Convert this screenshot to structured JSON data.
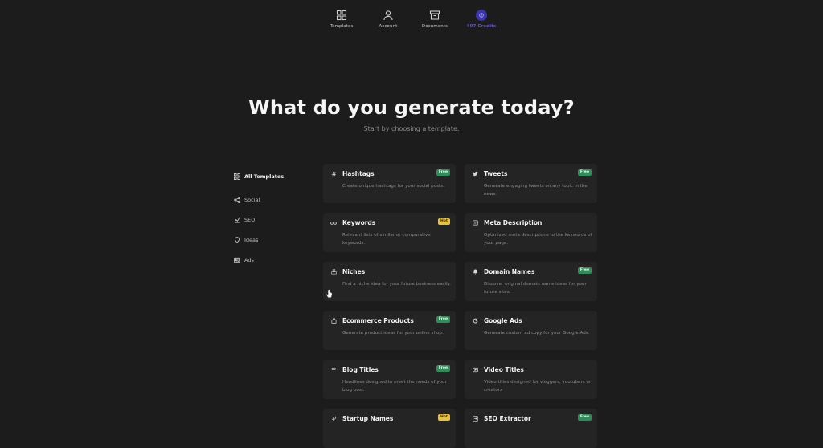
{
  "nav": {
    "items": [
      {
        "label": "Templates",
        "icon": "grid-icon"
      },
      {
        "label": "Account",
        "icon": "user-icon"
      },
      {
        "label": "Documents",
        "icon": "archive-icon"
      },
      {
        "label": "497 Credits",
        "icon": "credits-icon"
      }
    ]
  },
  "hero": {
    "title": "What do you generate today?",
    "subtitle": "Start by choosing a template."
  },
  "sidebar": {
    "items": [
      {
        "label": "All Templates",
        "icon": "grid-icon",
        "active": true
      },
      {
        "label": "Social",
        "icon": "share-icon"
      },
      {
        "label": "SEO",
        "icon": "trend-icon"
      },
      {
        "label": "Ideas",
        "icon": "lightbulb-icon"
      },
      {
        "label": "Ads",
        "icon": "ad-icon"
      }
    ]
  },
  "templates": [
    {
      "title": "Hashtags",
      "desc": "Create unique hashtags for your social posts.",
      "badge": "Free",
      "badge_type": "free",
      "icon": "hash-icon"
    },
    {
      "title": "Tweets",
      "desc": "Generate engaging tweets on any topic in the news.",
      "badge": "Free",
      "badge_type": "free",
      "icon": "twitter-icon"
    },
    {
      "title": "Keywords",
      "desc": "Relevant lists of similar or comparative keywords.",
      "badge": "Hot",
      "badge_type": "hot",
      "icon": "infinity-icon"
    },
    {
      "title": "Meta Description",
      "desc": "Optimized meta descriptions to the keywords of your page.",
      "badge": "",
      "badge_type": "",
      "icon": "document-icon"
    },
    {
      "title": "Niches",
      "desc": "Find a niche idea for your future business easily.",
      "badge": "",
      "badge_type": "",
      "icon": "cubes-icon"
    },
    {
      "title": "Domain Names",
      "desc": "Discover original domain name ideas for your future sites.",
      "badge": "Free",
      "badge_type": "free",
      "icon": "bell-icon"
    },
    {
      "title": "Ecommerce Products",
      "desc": "Generate product ideas for your online shop.",
      "badge": "Free",
      "badge_type": "free",
      "icon": "bag-icon"
    },
    {
      "title": "Google Ads",
      "desc": "Generate custom ad copy for your Google Ads.",
      "badge": "",
      "badge_type": "",
      "icon": "google-icon"
    },
    {
      "title": "Blog Titles",
      "desc": "Headlines designed to meet the needs of your blog post.",
      "badge": "Free",
      "badge_type": "free",
      "icon": "signpost-icon"
    },
    {
      "title": "Video Titles",
      "desc": "Video titles designed for vloggers, youtubers or creators",
      "badge": "",
      "badge_type": "",
      "icon": "video-icon"
    },
    {
      "title": "Startup Names",
      "desc": "",
      "badge": "Hot",
      "badge_type": "hot",
      "icon": "rocket-icon"
    },
    {
      "title": "SEO Extractor",
      "desc": "",
      "badge": "Free",
      "badge_type": "free",
      "icon": "extract-icon"
    }
  ],
  "colors": {
    "background": "#1d1c1c",
    "card": "#252424",
    "accent": "#5b54d6",
    "free_badge": "#2f8e57",
    "hot_badge": "#e8c23a"
  }
}
